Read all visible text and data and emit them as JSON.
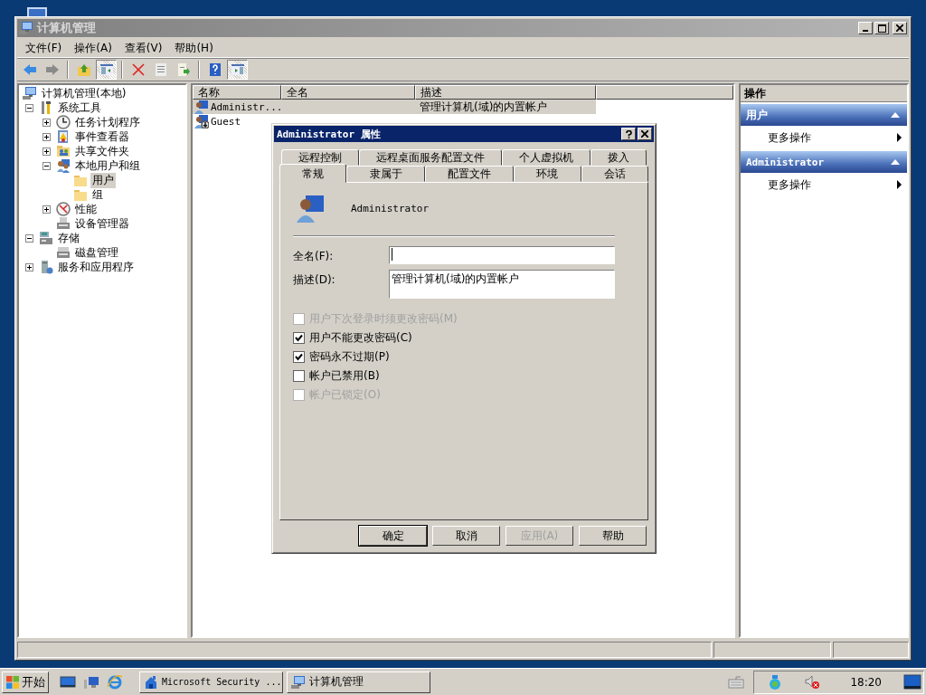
{
  "window": {
    "title": "计算机管理"
  },
  "menu": [
    "文件(F)",
    "操作(A)",
    "查看(V)",
    "帮助(H)"
  ],
  "toolbar": [
    [
      {
        "kind": "back",
        "pressed": false
      },
      {
        "kind": "forward",
        "pressed": false
      }
    ],
    [
      {
        "kind": "up",
        "pressed": false
      },
      {
        "kind": "tree",
        "pressed": true
      }
    ],
    [
      {
        "kind": "delete",
        "pressed": false
      },
      {
        "kind": "properties",
        "pressed": false
      },
      {
        "kind": "export",
        "pressed": false
      }
    ],
    [
      {
        "kind": "help",
        "pressed": false
      },
      {
        "kind": "pane",
        "pressed": true
      }
    ]
  ],
  "tree": [
    {
      "label": "计算机管理(本地)",
      "kind": "computer",
      "toggle": false,
      "selected": false,
      "children": [
        {
          "label": "系统工具",
          "kind": "tools",
          "toggle": true,
          "expanded": true,
          "selected": false,
          "children": [
            {
              "label": "任务计划程序",
              "kind": "clock",
              "toggle": true,
              "expanded": false,
              "selected": false
            },
            {
              "label": "事件查看器",
              "kind": "event",
              "toggle": true,
              "expanded": false,
              "selected": false
            },
            {
              "label": "共享文件夹",
              "kind": "share",
              "toggle": true,
              "expanded": false,
              "selected": false
            },
            {
              "label": "本地用户和组",
              "kind": "users",
              "toggle": true,
              "expanded": true,
              "selected": false,
              "children": [
                {
                  "label": "用户",
                  "kind": "folder",
                  "toggle": false,
                  "selected": true
                },
                {
                  "label": "组",
                  "kind": "folder",
                  "toggle": false,
                  "selected": false
                }
              ]
            },
            {
              "label": "性能",
              "kind": "perf",
              "toggle": true,
              "expanded": false,
              "selected": false
            },
            {
              "label": "设备管理器",
              "kind": "device",
              "toggle": false,
              "selected": false
            }
          ]
        },
        {
          "label": "存储",
          "kind": "storage",
          "toggle": true,
          "expanded": true,
          "selected": false,
          "children": [
            {
              "label": "磁盘管理",
              "kind": "disk",
              "toggle": false,
              "selected": false
            }
          ]
        },
        {
          "label": "服务和应用程序",
          "kind": "services",
          "toggle": true,
          "expanded": false,
          "selected": false
        }
      ]
    }
  ],
  "list": {
    "columns": [
      "名称",
      "全名",
      "描述"
    ],
    "rows": [
      {
        "name": "Administr...",
        "description": "管理计算机(域)的内置帐户",
        "kind": "admin",
        "selected": true
      },
      {
        "name": "Guest",
        "kind": "guest",
        "selected": false
      }
    ]
  },
  "actions": {
    "title": "操作",
    "sections": [
      {
        "title": "用户",
        "items": [
          "更多操作"
        ]
      },
      {
        "title": "Administrator",
        "items": [
          "更多操作"
        ]
      }
    ]
  },
  "dialog": {
    "title": "Administrator 属性",
    "tab_rows": [
      [
        {
          "label": "远程控制",
          "selected": false
        },
        {
          "label": "远程桌面服务配置文件",
          "selected": false
        },
        {
          "label": "个人虚拟机",
          "selected": false
        },
        {
          "label": "拨入",
          "selected": false
        }
      ],
      [
        {
          "label": "常规",
          "selected": true
        },
        {
          "label": "隶属于",
          "selected": false
        },
        {
          "label": "配置文件",
          "selected": false
        },
        {
          "label": "环境",
          "selected": false
        },
        {
          "label": "会话",
          "selected": false
        }
      ]
    ],
    "user_name": "Administrator",
    "fields": [
      {
        "label": "全名(F):",
        "kind": "line"
      },
      {
        "label": "描述(D):",
        "value": "管理计算机(域)的内置帐户",
        "kind": "box"
      }
    ],
    "checkboxes": [
      {
        "label": "用户下次登录时须更改密码(M)",
        "checked": false,
        "disabled": true
      },
      {
        "label": "用户不能更改密码(C)",
        "checked": true,
        "disabled": false
      },
      {
        "label": "密码永不过期(P)",
        "checked": true,
        "disabled": false
      },
      {
        "label": "帐户已禁用(B)",
        "checked": false,
        "disabled": false
      },
      {
        "label": "帐户已锁定(O)",
        "checked": false,
        "disabled": true
      }
    ],
    "buttons": [
      {
        "label": "确定",
        "default": true,
        "disabled": false
      },
      {
        "label": "取消",
        "default": false,
        "disabled": false
      },
      {
        "label": "应用(A)",
        "default": false,
        "disabled": true
      },
      {
        "label": "帮助",
        "default": false,
        "disabled": false
      }
    ]
  },
  "taskbar": {
    "start": "开始",
    "tasks": [
      {
        "label": "Microsoft Security ...",
        "kind": "security"
      },
      {
        "label": "计算机管理",
        "kind": "computer"
      }
    ],
    "clock": "18:20"
  }
}
